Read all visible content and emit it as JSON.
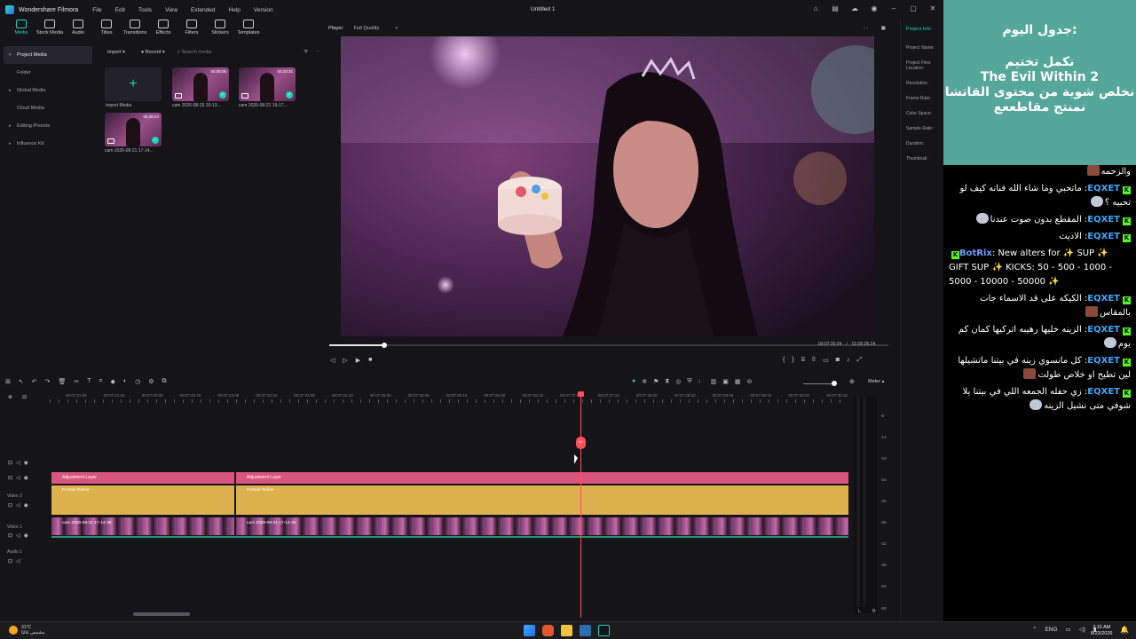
{
  "app": {
    "name": "Wondershare Filmora",
    "menu": [
      "File",
      "Edit",
      "Tools",
      "View",
      "Extended",
      "Help",
      "Version"
    ],
    "document_title": "Untitled 1"
  },
  "toolbar": {
    "items": [
      "Media",
      "Stock Media",
      "Audio",
      "Titles",
      "Transitions",
      "Effects",
      "Filters",
      "Stickers",
      "Templates"
    ],
    "active": "Media"
  },
  "sidebar": {
    "items": [
      "Project Media",
      "Folder",
      "Global Media",
      "Cloud Media",
      "Editing Presets",
      "Influence Kit"
    ]
  },
  "media": {
    "import_label": "Import",
    "record_label": "Record",
    "search_placeholder": "Search media",
    "import_tile_label": "Import Media",
    "clips": [
      {
        "name": "cam 2026-08-23 20-13...",
        "duration": "00:08:05"
      },
      {
        "name": "cam 2026-08-21 19-17...",
        "duration": "00:33:31"
      },
      {
        "name": "cam 2026-08-21 17-14...",
        "duration": "00:46:44"
      }
    ]
  },
  "player": {
    "label": "Player",
    "quality": "Full Quality",
    "current_time": "00:07:20:24",
    "total_time": "01:05:26:24",
    "progress_fraction": 0.1
  },
  "project_info": {
    "tab": "Project Info",
    "fields": [
      "Project Name:",
      "Project Files Location:",
      "Resolution:",
      "Frame Rate:",
      "Color Space:",
      "Sample Rate:",
      "Duration:",
      "Thumbnail:"
    ]
  },
  "timeline": {
    "meter_label": "Meter",
    "ruler_labels": [
      "00:07:21:05",
      "00:07:21:10",
      "00:07:22:00",
      "00:07:22:10",
      "00:07:23:05",
      "00:07:23:10",
      "00:07:24:00",
      "00:07:24:10",
      "00:07:25:00",
      "00:07:25:05",
      "00:07:25:10",
      "00:07:26:00",
      "00:07:26:10",
      "00:07:27:05",
      "00:07:27:10",
      "00:07:28:00",
      "00:07:28:10",
      "00:07:29:05",
      "00:07:29:10",
      "00:07:30:00",
      "00:07:30:10"
    ],
    "tracks": [
      "Video 2",
      "Video 1",
      "Audio 1"
    ],
    "adjustment_layer_label": "Adjustment Layer",
    "portrait_label": "Portrait Refine",
    "cam_clip_label": "cam 2026-08-21 17-14-35",
    "meter_scale": [
      "-6",
      "-12",
      "-18",
      "-24",
      "-30",
      "-36",
      "-42",
      "-48",
      "-54",
      "-60"
    ],
    "meter_lr": "L R"
  },
  "overlay": {
    "notes": {
      "title": "جدول اليوم:",
      "lines": [
        "نكمل تختيم",
        "The Evil Within 2",
        "نخلص شوية من محتوى القاتشا",
        "نمنتج مقاطععع"
      ]
    },
    "chat": [
      {
        "user": "",
        "text": "والزحمه"
      },
      {
        "user": "EQXET",
        "text": "ماتحبي وما شاء الله فنانه كيف لو تحبيه ؟"
      },
      {
        "user": "EQXET",
        "text": "المقطع بدون صوت عندنا"
      },
      {
        "user": "EQXET",
        "text": "الاديث"
      },
      {
        "user": "BotRix",
        "text": "New alters for ✨ SUP ✨ GIFT SUP ✨ KICKS: 50 - 500 - 1000 - 5000 - 10000 - 50000 ✨"
      },
      {
        "user": "EQXET",
        "text": "الكيكه على قد الاسماء جات بالمقاس"
      },
      {
        "user": "EQXET",
        "text": "الزينه خليها رهيبه اتركيها كمان كم يوم"
      },
      {
        "user": "EQXET",
        "text": "كل مانسوي زينه في بيتنا ماتشيلها لين تطيح او خلاص طولت"
      },
      {
        "user": "EQXET",
        "text": "زي حفله الجمعه اللي في بيتنا يلا شوفي متى نشيل الزينه"
      }
    ]
  },
  "taskbar": {
    "temp": "31°C",
    "weather": "مشمس غالبًا",
    "lang": "ENG",
    "time": "7:15 AM",
    "date": "8/23/2026"
  },
  "colors": {
    "accent": "#19d3b5",
    "adjustment": "#d9547f",
    "portrait": "#dcb14e",
    "playhead": "#ff4f58",
    "notes_bg": "#54a79a"
  }
}
